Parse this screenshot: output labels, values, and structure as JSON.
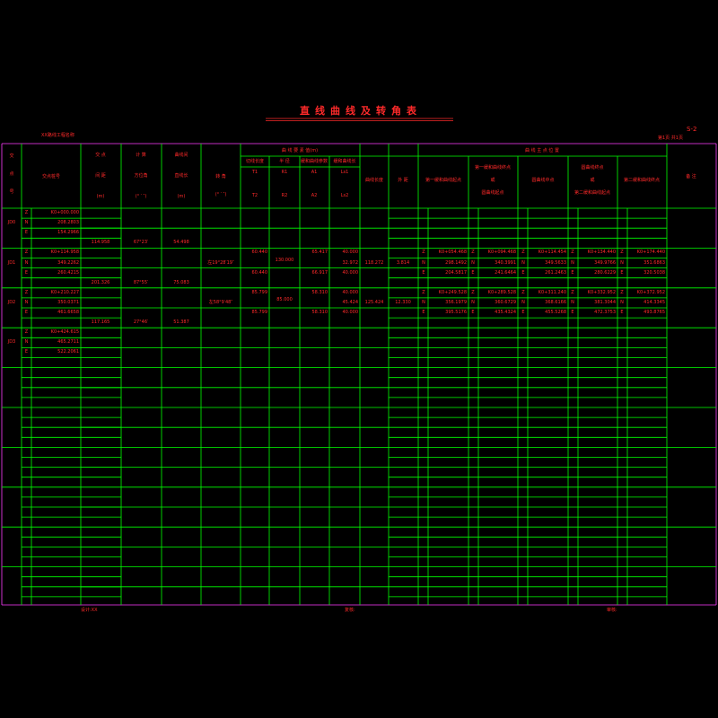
{
  "title": "直线曲线及转角表",
  "project": "XX路线工程名称",
  "sheet_no": "S-2",
  "page_info": "第1页 共1页",
  "headers": {
    "jd": [
      "交",
      "点",
      "号"
    ],
    "coord": "交点桩号",
    "angle_val": [
      "交 点",
      "间 距",
      "(m)"
    ],
    "dir": [
      "计 算",
      "方位角",
      "(° ′ ″)"
    ],
    "dist": [
      "曲线间",
      "直线长",
      "(m)"
    ],
    "deflection": [
      "转 角",
      "(° ′ ″)"
    ],
    "curve_group": "曲 线 要 素 值(m)",
    "sub": [
      {
        "top": "切线长度",
        "mid": "T1",
        "bot": "T2"
      },
      {
        "top": "半 径",
        "mid": "R1",
        "bot": "R2"
      },
      {
        "top": "缓和曲线参数",
        "mid": "A1",
        "bot": "A2"
      },
      {
        "top": "缓和曲线长",
        "mid": "Ls1",
        "bot": "Ls2"
      }
    ],
    "curve_len": "曲线长度",
    "ext": "外 距",
    "pos_group": "曲 线 主 点 位 置",
    "pos": [
      [
        "第一缓和曲线起点"
      ],
      [
        "第一缓和曲线终点",
        "或",
        "圆曲线起点"
      ],
      [
        "圆曲线中点"
      ],
      [
        "圆曲线终点",
        "或",
        "第二缓和曲线起点"
      ],
      [
        "第二缓和曲线终点"
      ]
    ],
    "remark": "备 注"
  },
  "jd_rows": [
    {
      "jd": "JD0",
      "lines": [
        [
          "Z",
          "K0+000.000"
        ],
        [
          "N",
          "208.2803"
        ],
        [
          "E",
          "154.2966"
        ]
      ]
    },
    {
      "jd": "JD1",
      "lines": [
        [
          "Z",
          "K0+114.958"
        ],
        [
          "N",
          "349.2262"
        ],
        [
          "E",
          "260.4215"
        ]
      ]
    },
    {
      "jd": "JD2",
      "lines": [
        [
          "Z",
          "K0+210.227"
        ],
        [
          "N",
          "350.0371"
        ],
        [
          "E",
          "461.6658"
        ]
      ]
    },
    {
      "jd": "JD3",
      "lines": [
        [
          "Z",
          "K0+424.615"
        ],
        [
          "N",
          "465.2711"
        ],
        [
          "E",
          "522.2061"
        ]
      ]
    }
  ],
  "spans": [
    {
      "dist": "114.958",
      "dir": "67°23′",
      "straight": "54.498"
    },
    {
      "dist": "201.326",
      "dir": "87°55′",
      "straight": "75.083"
    },
    {
      "dist": "117.165",
      "dir": "27°46′",
      "straight": "51.387"
    }
  ],
  "curves": [
    {
      "defl": "左19°28′19″",
      "T": [
        "60.440",
        "60.440"
      ],
      "R": "130.000",
      "A": [
        "65.417",
        "66.917"
      ],
      "Ls": [
        "40.000",
        "32.972",
        "40.000"
      ],
      "L": "118.272",
      "E": "3.814",
      "pts": [
        [
          "Z",
          "K0+054.468"
        ],
        [
          "Z",
          "K0+094.468"
        ],
        [
          "Z",
          "K0+114.454"
        ],
        [
          "Z",
          "K0+134.440"
        ],
        [
          "Z",
          "K0+174.440"
        ]
      ],
      "ns": [
        [
          "N",
          "298.1492",
          "N",
          "340.3991",
          "N",
          "349.5633",
          "N",
          "349.9766",
          "N",
          "351.6863"
        ],
        [
          "E",
          "204.5817",
          "E",
          "241.6464",
          "E",
          "261.2463",
          "E",
          "280.6229",
          "E",
          "320.5038"
        ]
      ]
    },
    {
      "defl": "左58°9′48″",
      "T": [
        "85.799",
        "85.799"
      ],
      "R": "85.000",
      "A": [
        "58.310",
        "58.310"
      ],
      "Ls": [
        "40.000",
        "45.424",
        "40.000"
      ],
      "L": "125.424",
      "E": "12.330",
      "pts": [
        [
          "Z",
          "K0+249.528"
        ],
        [
          "Z",
          "K0+289.528"
        ],
        [
          "Z",
          "K0+311.240"
        ],
        [
          "Z",
          "K0+332.952"
        ],
        [
          "Z",
          "K0+372.952"
        ]
      ],
      "ns": [
        [
          "N",
          "356.1979",
          "N",
          "360.6729",
          "N",
          "368.6166",
          "N",
          "381.3044",
          "N",
          "414.3345"
        ],
        [
          "E",
          "395.5176",
          "E",
          "435.4324",
          "E",
          "455.5268",
          "E",
          "472.3753",
          "E",
          "493.8765"
        ]
      ]
    }
  ],
  "footer": {
    "designer": "设计:XX",
    "checker": "复核:",
    "reviewer": "审核:"
  },
  "colors": {
    "grid": "#00ff00",
    "frame": "#ff3cff",
    "text": "#ff2a2a",
    "bg": "#000000"
  }
}
